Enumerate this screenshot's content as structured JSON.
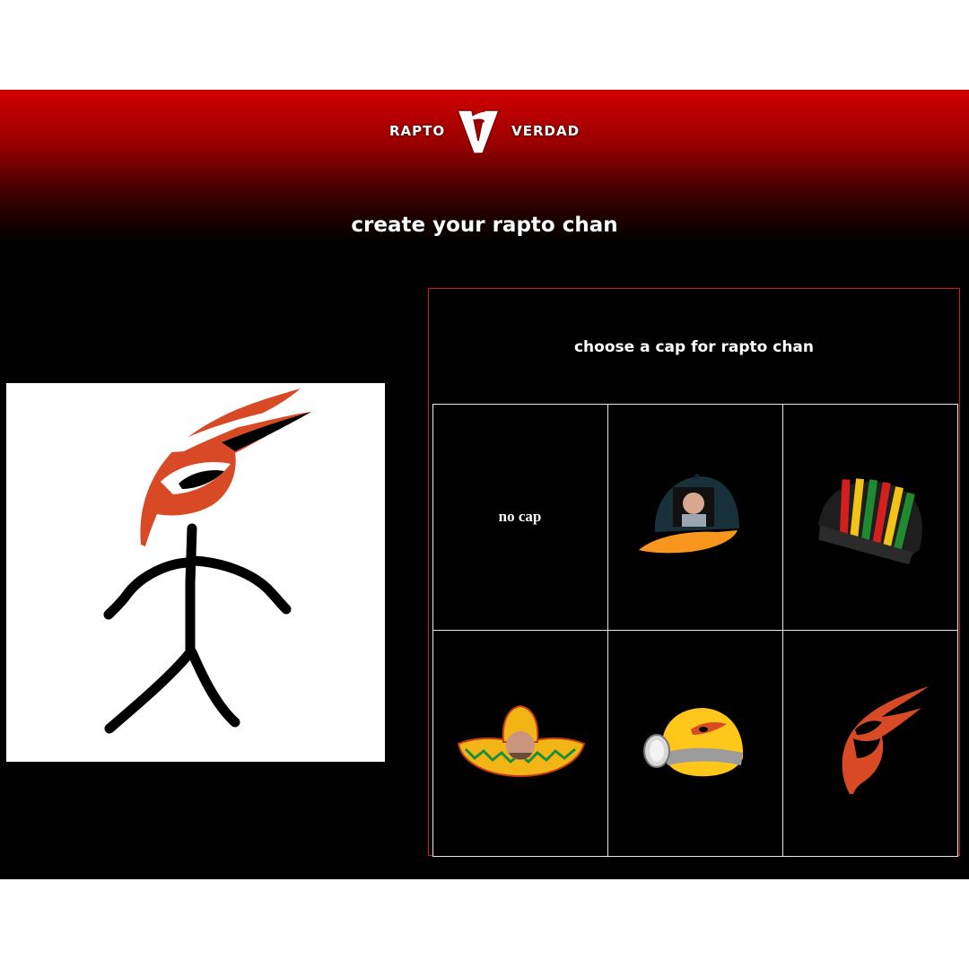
{
  "header": {
    "brand_left": "RAPTO",
    "brand_right": "VERDAD",
    "logo_icon": "rapto-v-logo-icon",
    "gradient_top": "#d20000",
    "gradient_bottom": "#000000"
  },
  "page_title": "create your rapto chan",
  "preview": {
    "icon": "stick-figure-with-red-bird-cap-icon"
  },
  "cap_panel": {
    "title": "choose a cap for rapto chan",
    "border_color": "#d11a1a",
    "options": [
      {
        "label": "no cap",
        "icon": ""
      },
      {
        "label": "",
        "icon": "photo-baseball-cap-icon"
      },
      {
        "label": "",
        "icon": "rasta-beanie-icon"
      },
      {
        "label": "",
        "icon": "sombrero-icon"
      },
      {
        "label": "",
        "icon": "miner-helmet-icon"
      },
      {
        "label": "",
        "icon": "red-bird-crest-icon"
      }
    ]
  },
  "colors": {
    "accent_red": "#d11a1a",
    "bird_orange": "#d84a26",
    "background": "#000000"
  }
}
